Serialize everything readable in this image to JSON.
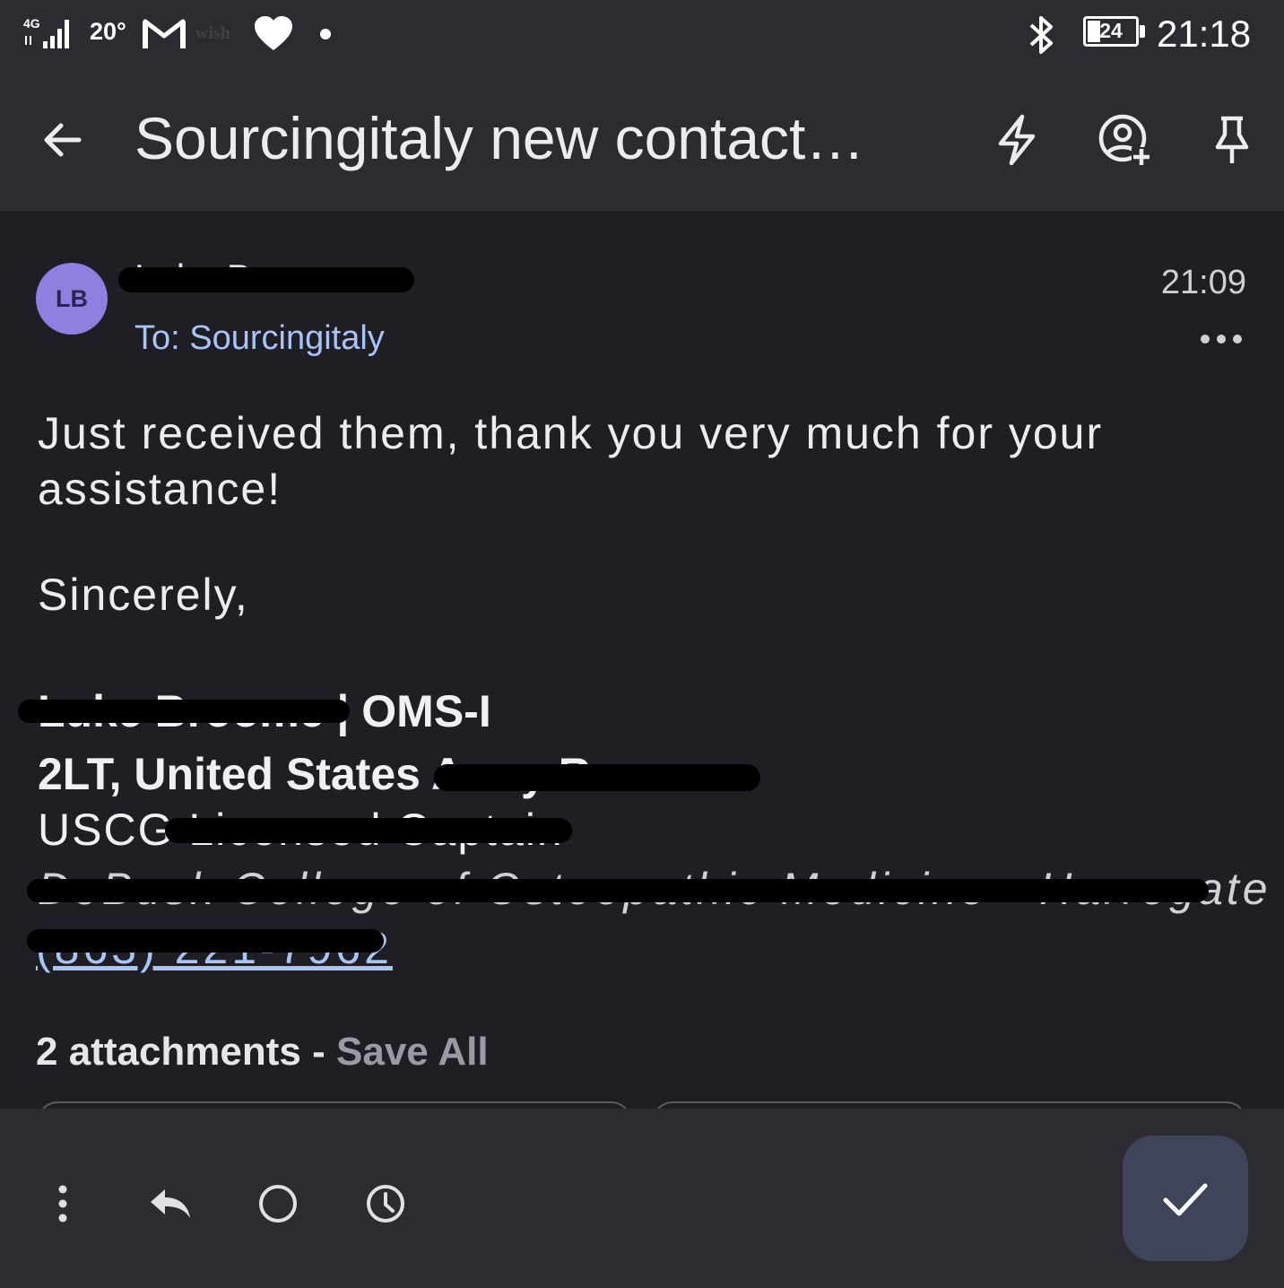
{
  "status_bar": {
    "network": "4G",
    "temperature": "20°",
    "wish_label": "wish",
    "battery_level": "24",
    "time": "21:18"
  },
  "toolbar": {
    "title": "Sourcingitaly new contact…",
    "icons": [
      "back-arrow-icon",
      "lightning-icon",
      "add-contact-icon",
      "pin-icon"
    ]
  },
  "message": {
    "avatar_initials": "LB",
    "sender": "Luke Broome",
    "to_line": "To: Sourcingitaly",
    "time": "21:09",
    "body": "Just received them, thank you very much for your assistance!",
    "closing": "Sincerely,",
    "signature": {
      "line1_name": "Luke Broome",
      "line1_suffix": " | OMS-I",
      "line2_visible": "2LT, United States",
      "line2_redacted": " Army Reserve",
      "line3_visible": "USCG",
      "line3_redacted": " Licensed Captain",
      "line4": "DeBusk College of Osteopathic Medicine - Harrogate",
      "phone": "(863) 221-7962"
    }
  },
  "attachments": {
    "count_label": "2 attachments",
    "separator": " - ",
    "save_all": "Save All"
  },
  "bottom_bar": {
    "icons": [
      "more-vert-icon",
      "reply-icon",
      "circle-icon",
      "clock-icon",
      "check-icon"
    ]
  },
  "colors": {
    "background": "#1e1e24",
    "bars": "#2b2b31",
    "accent_link": "#a7c4f4",
    "avatar": "#8e7fe0",
    "fab": "#3e4459"
  }
}
